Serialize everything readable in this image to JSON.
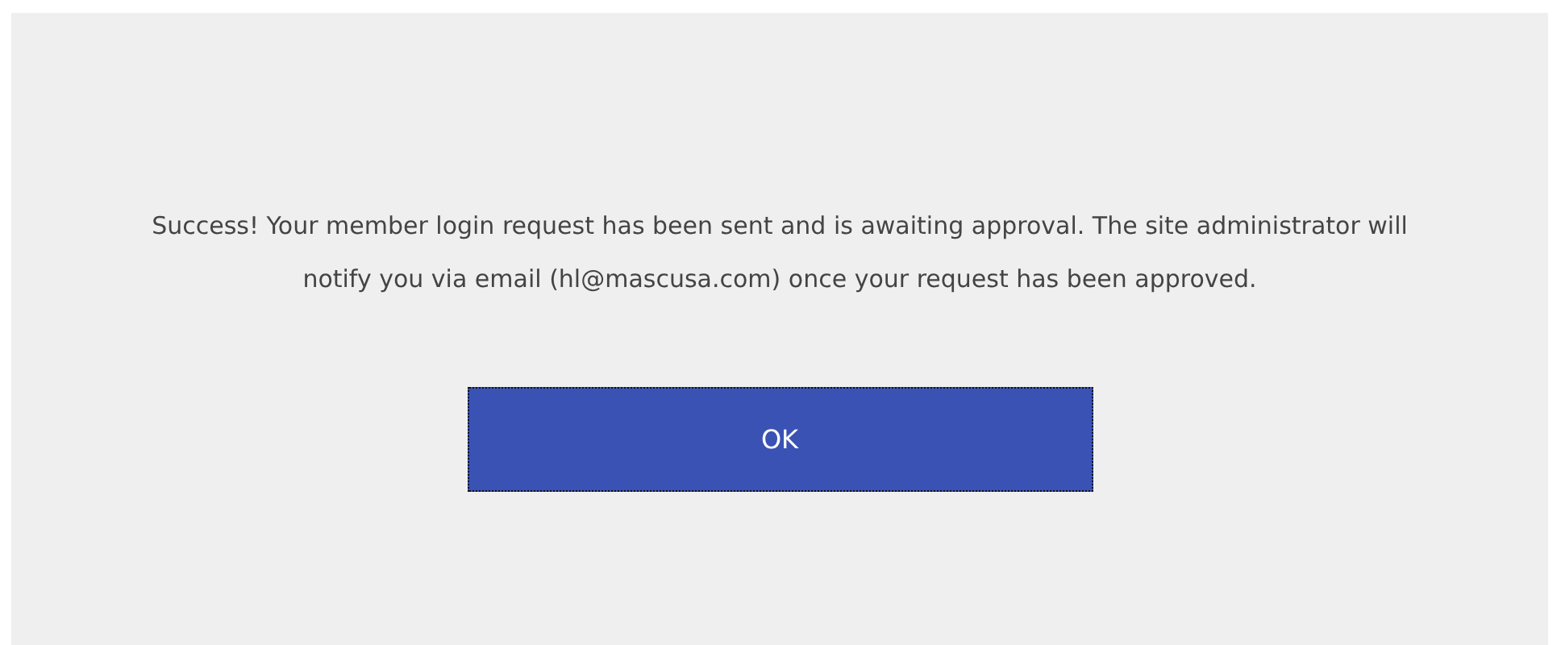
{
  "message": "Success! Your member login request has been sent and is awaiting approval. The site administrator will notify you via email (hl@mascusa.com) once your request has been approved.",
  "button": {
    "label": "OK",
    "focused": true
  }
}
